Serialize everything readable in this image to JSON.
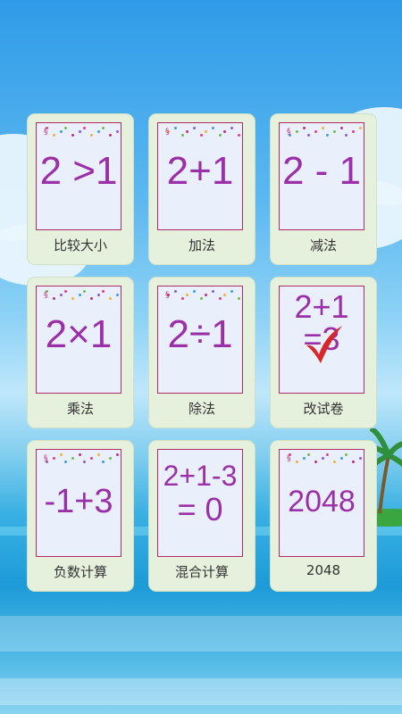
{
  "cards": [
    {
      "label": "比较大小",
      "lines": [
        "2 >1"
      ]
    },
    {
      "label": "加法",
      "lines": [
        "2+1"
      ]
    },
    {
      "label": "减法",
      "lines": [
        "2 - 1"
      ]
    },
    {
      "label": "乘法",
      "lines": [
        "2×1"
      ]
    },
    {
      "label": "除法",
      "lines": [
        "2÷1"
      ]
    },
    {
      "label": "改试卷",
      "lines": [
        "2+1",
        "=3"
      ]
    },
    {
      "label": "负数计算",
      "lines": [
        "-1+3"
      ]
    },
    {
      "label": "混合计算",
      "lines": [
        "2+1-3",
        "= 0"
      ]
    },
    {
      "label": "2048",
      "lines": [
        "2048"
      ]
    }
  ],
  "colors": {
    "accent": "#9b2fa8",
    "frame": "#b02a66",
    "check": "#d8262a"
  },
  "icons": {
    "correct_mark": "check-mark-icon"
  }
}
